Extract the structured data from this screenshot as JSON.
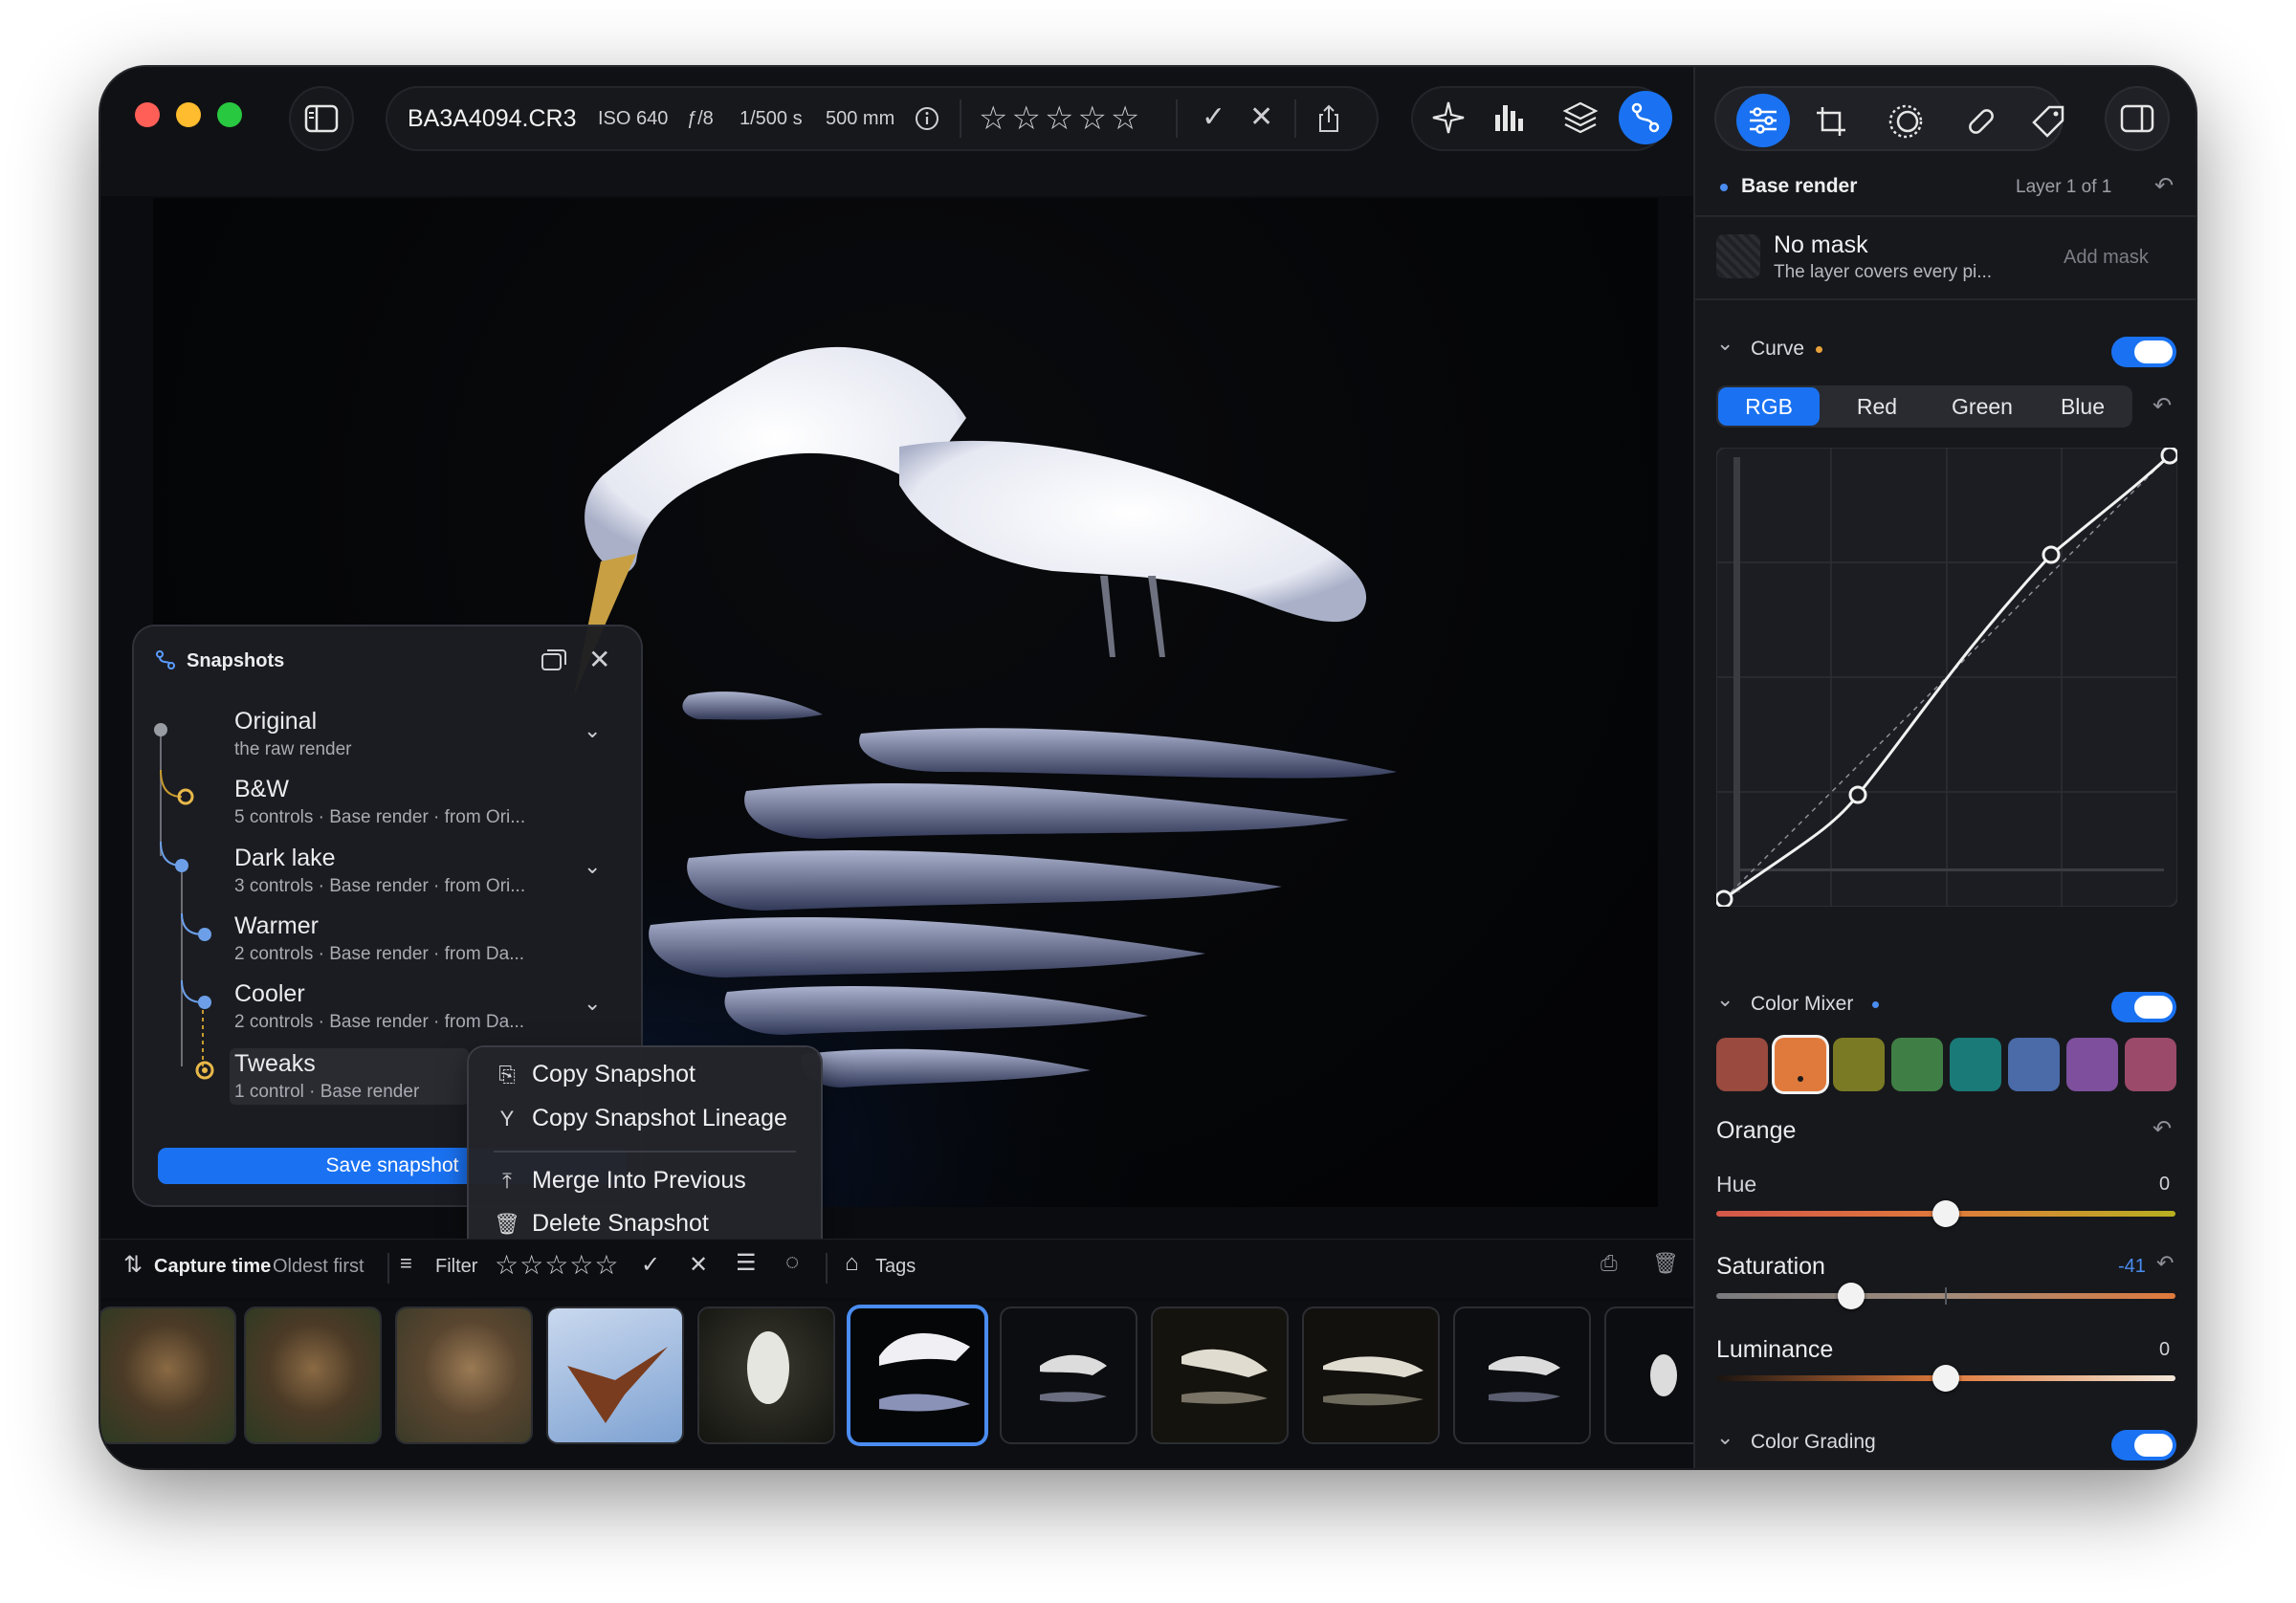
{
  "toolbar": {
    "filename": "BA3A4094.CR3",
    "iso": "ISO 640",
    "aperture": "ƒ/8",
    "shutter": "1/500 s",
    "focal": "500 mm"
  },
  "snapshots": {
    "title": "Snapshots",
    "items": [
      {
        "name": "Original",
        "desc": "the raw render"
      },
      {
        "name": "B&W",
        "desc": "5 controls · Base render · from Ori..."
      },
      {
        "name": "Dark lake",
        "desc": "3 controls · Base render · from Ori..."
      },
      {
        "name": "Warmer",
        "desc": "2 controls · Base render · from Da..."
      },
      {
        "name": "Cooler",
        "desc": "2 controls · Base render · from Da..."
      },
      {
        "name": "Tweaks",
        "desc": "1 control · Base render"
      }
    ],
    "save_label": "Save snapshot"
  },
  "context_menu": {
    "copy": "Copy Snapshot",
    "copy_lineage": "Copy Snapshot Lineage",
    "merge": "Merge Into Previous",
    "delete": "Delete Snapshot"
  },
  "filmbar": {
    "sort_label": "Capture time",
    "sort_order": "Oldest first",
    "filter_label": "Filter",
    "tags_label": "Tags"
  },
  "panel": {
    "layer_name": "Base render",
    "layer_count": "Layer 1 of 1",
    "mask_title": "No mask",
    "mask_desc": "The layer covers every pi...",
    "add_mask": "Add mask",
    "curve_title": "Curve",
    "curve_tabs": [
      "RGB",
      "Red",
      "Green",
      "Blue"
    ],
    "mixer_title": "Color Mixer",
    "swatch_colors": [
      "#9a4a3f",
      "#e07a3c",
      "#7a7a24",
      "#3f7f45",
      "#1a7a78",
      "#4a6aa8",
      "#7d4f9c",
      "#9c4a6a"
    ],
    "selected_color": "Orange",
    "hue_label": "Hue",
    "hue_value": "0",
    "saturation_label": "Saturation",
    "saturation_value": "-41",
    "luminance_label": "Luminance",
    "luminance_value": "0",
    "grading_title": "Color Grading"
  },
  "colors": {
    "accent": "#1a72f2",
    "curve_dot_yellow": "#e8b94a"
  }
}
